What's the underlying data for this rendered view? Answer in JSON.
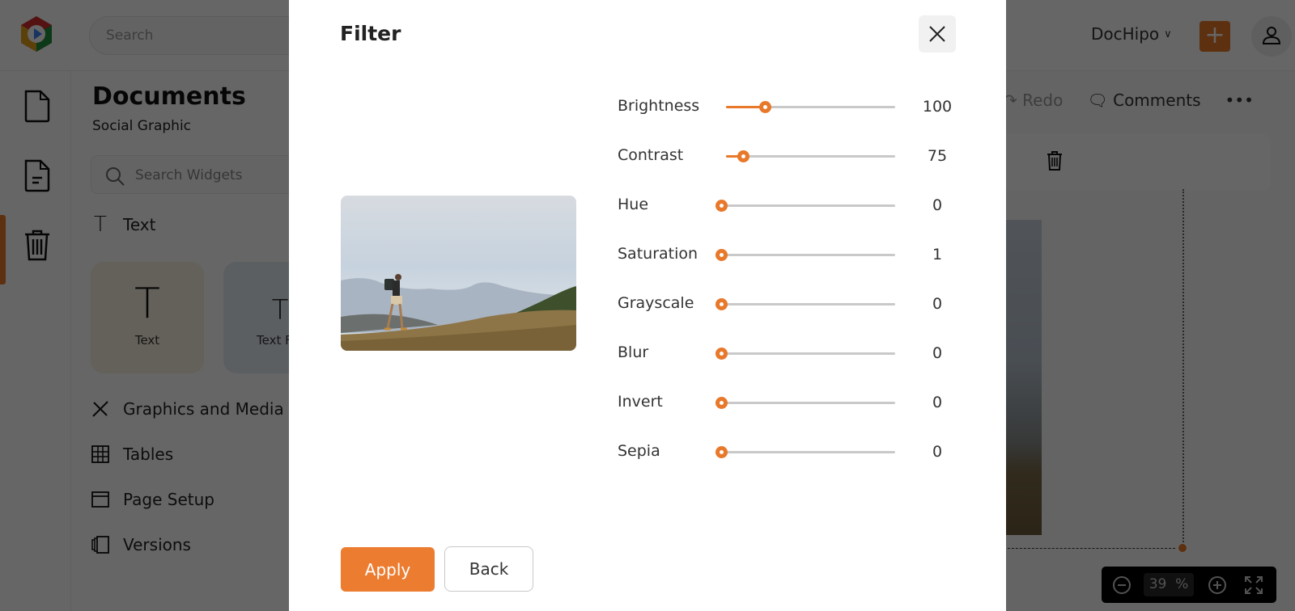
{
  "app": {
    "top_search_placeholder": "Search",
    "account_name": "DocHipo",
    "panel_title": "Documents",
    "panel_subtitle": "Social Graphic",
    "widget_search_placeholder": "Search Widgets",
    "text_section_label": "Text",
    "tiles": [
      {
        "label": "Text",
        "glyph": "T",
        "bg": "#fbf3e1"
      },
      {
        "label": "Text Fra",
        "glyph": "T",
        "bg": "#e6eef5"
      }
    ],
    "sections": [
      {
        "label": "Graphics and Media",
        "icon": "pencil-ruler-icon"
      },
      {
        "label": "Tables",
        "icon": "table-grid-icon"
      },
      {
        "label": "Page Setup",
        "icon": "page-setup-icon"
      },
      {
        "label": "Versions",
        "icon": "versions-icon"
      }
    ],
    "toolbar": {
      "redo_label": "Redo",
      "comments_label": "Comments",
      "more_label": "•••"
    },
    "zoom": {
      "value": "39",
      "unit": "%"
    }
  },
  "modal": {
    "title": "Filter",
    "filters": [
      {
        "name": "Brightness",
        "value": "100",
        "fill_fraction": 0.23
      },
      {
        "name": "Contrast",
        "value": "75",
        "fill_fraction": 0.1
      },
      {
        "name": "Hue",
        "value": "0",
        "fill_fraction": 0
      },
      {
        "name": "Saturation",
        "value": "1",
        "fill_fraction": 0
      },
      {
        "name": "Grayscale",
        "value": "0",
        "fill_fraction": 0
      },
      {
        "name": "Blur",
        "value": "0",
        "fill_fraction": 0
      },
      {
        "name": "Invert",
        "value": "0",
        "fill_fraction": 0
      },
      {
        "name": "Sepia",
        "value": "0",
        "fill_fraction": 0
      }
    ],
    "apply_label": "Apply",
    "back_label": "Back",
    "accent_color": "#e8782a"
  }
}
